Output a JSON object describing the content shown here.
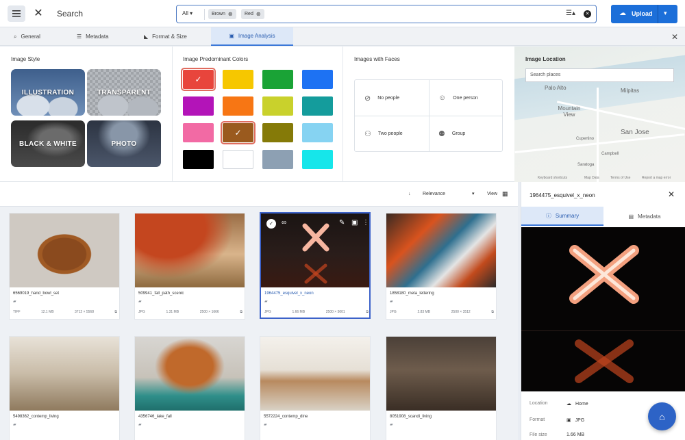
{
  "topbar": {
    "search_title": "Search",
    "scope": "All",
    "chips": [
      "Brown",
      "Red"
    ],
    "upload_label": "Upload"
  },
  "tabs": [
    {
      "label": "General",
      "icon": "search-icon"
    },
    {
      "label": "Metadata",
      "icon": "list-icon"
    },
    {
      "label": "Format & Size",
      "icon": "ruler-icon"
    },
    {
      "label": "Image Analysis",
      "icon": "image-icon",
      "active": true
    }
  ],
  "filters": {
    "image_style": {
      "title": "Image Style",
      "tiles": [
        "ILLUSTRATION",
        "TRANSPARENT",
        "BLACK & WHITE",
        "PHOTO"
      ]
    },
    "colors": {
      "title": "Image Predominant Colors",
      "swatches": [
        {
          "hex": "#e8453c",
          "selected": true
        },
        {
          "hex": "#f6c700",
          "selected": false
        },
        {
          "hex": "#1aa336",
          "selected": false
        },
        {
          "hex": "#1d72f3",
          "selected": false
        },
        {
          "hex": "#b314b8",
          "selected": false
        },
        {
          "hex": "#f77614",
          "selected": false
        },
        {
          "hex": "#c9d12c",
          "selected": false
        },
        {
          "hex": "#149c9c",
          "selected": false
        },
        {
          "hex": "#f26aa4",
          "selected": false
        },
        {
          "hex": "#9a5a1e",
          "selected": true
        },
        {
          "hex": "#857a08",
          "selected": false
        },
        {
          "hex": "#86d3f2",
          "selected": false
        },
        {
          "hex": "#000000",
          "selected": false
        },
        {
          "hex": "#ffffff",
          "selected": false
        },
        {
          "hex": "#8da0b3",
          "selected": false
        },
        {
          "hex": "#16e6ea",
          "selected": false
        }
      ]
    },
    "faces": {
      "title": "Images with Faces",
      "options": [
        "No people",
        "One person",
        "Two people",
        "Group"
      ]
    },
    "location": {
      "title": "Image Location",
      "search_placeholder": "Search places",
      "cities": [
        "Palo Alto",
        "Milpitas",
        "Mountain View",
        "San Jose",
        "Cupertino",
        "Campbell",
        "Saratoga"
      ],
      "footer": [
        "Keyboard shortcuts",
        "Map Data",
        "Terms of Use",
        "Report a map error"
      ]
    }
  },
  "results": {
    "sort_label": "Relevance",
    "view_label": "View"
  },
  "cards": [
    {
      "name": "6569019_hand_bowl_set",
      "type": "TIFF",
      "size": "12.1 MB",
      "dims": "3712 × 5568"
    },
    {
      "name": "509941_fall_path_scenic",
      "type": "JPG",
      "size": "1.31 MB",
      "dims": "2500 × 1666"
    },
    {
      "name": "1964475_esquivel_x_neon",
      "type": "JPG",
      "size": "1.66 MB",
      "dims": "2500 × 5001",
      "selected": true
    },
    {
      "name": "1858180_meta_lettering",
      "type": "JPG",
      "size": "2.83 MB",
      "dims": "2500 × 3512"
    },
    {
      "name": "5498362_contemp_living",
      "type": "",
      "size": "",
      "dims": ""
    },
    {
      "name": "4356746_lake_fall",
      "type": "",
      "size": "",
      "dims": ""
    },
    {
      "name": "5572224_contemp_dine",
      "type": "",
      "size": "",
      "dims": ""
    },
    {
      "name": "8051908_scandi_living",
      "type": "",
      "size": "",
      "dims": ""
    }
  ],
  "details": {
    "title": "1964475_esquivel_x_neon",
    "tabs": [
      "Summary",
      "Metadata"
    ],
    "props": [
      {
        "label": "Location",
        "value": "Home"
      },
      {
        "label": "Format",
        "value": "JPG"
      },
      {
        "label": "File size",
        "value": "1.66 MB"
      }
    ]
  }
}
